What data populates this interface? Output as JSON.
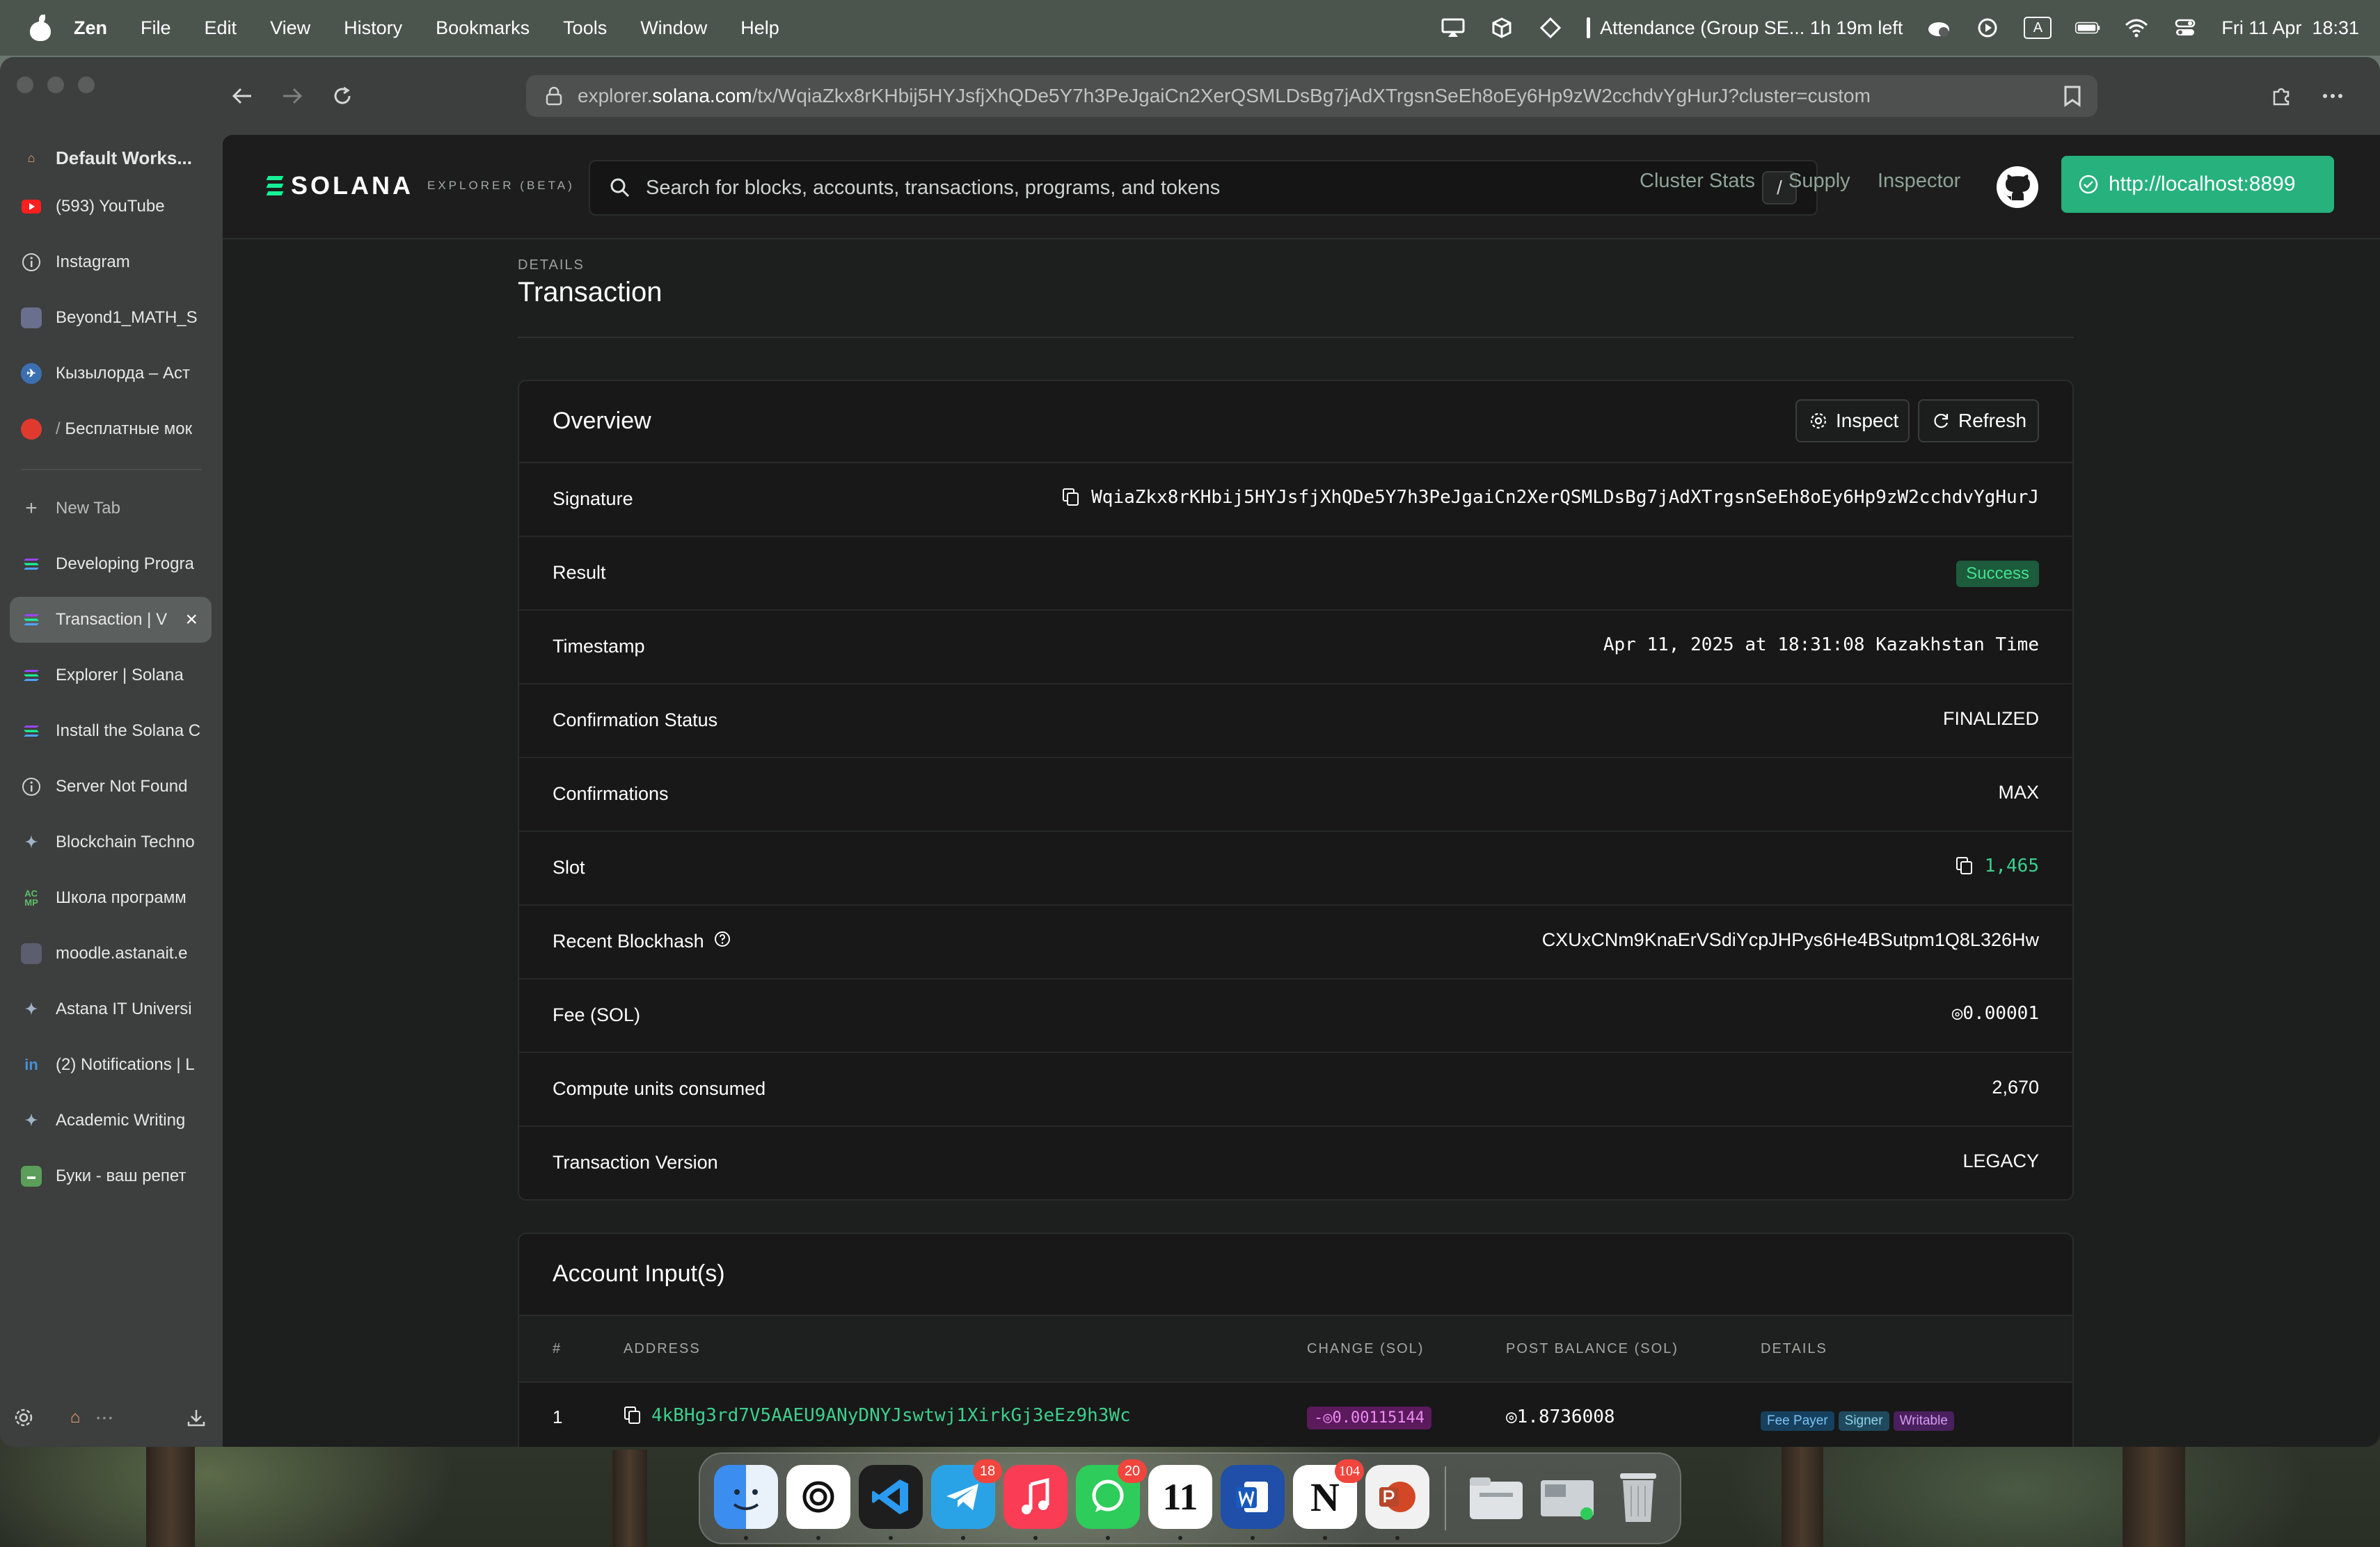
{
  "menubar": {
    "app_name": "Zen",
    "menus": [
      "File",
      "Edit",
      "View",
      "History",
      "Bookmarks",
      "Tools",
      "Window",
      "Help"
    ],
    "status_text": "Attendance (Group SE... 1h 19m left",
    "date_time": "Fri 11 Apr  18:31",
    "keyboard_input": "A"
  },
  "browser": {
    "url_prefix": "explorer.",
    "url_domain": "solana.com",
    "url_path": "/tx/WqiaZkx8rKHbij5HYJsfjXhQDe5Y7h3PeJgaiCn2XerQSMLDsBg7jAdXTrgsnSeEh8oEy6Hp9zW2cchdvYgHurJ?cluster=custom"
  },
  "sidebar": {
    "workspace": "Default Works...",
    "pinned": [
      {
        "label": "(593) YouTube",
        "icon": "youtube-icon"
      },
      {
        "label": "Instagram",
        "icon": "info-icon"
      },
      {
        "label": "Beyond1_MATH_S",
        "icon": "page-icon"
      },
      {
        "label": "Кызылорда – Аст",
        "icon": "plane-icon"
      },
      {
        "label": "Бесплатные мок",
        "icon": "red-dot-icon"
      }
    ],
    "new_tab": "New Tab",
    "tabs": [
      {
        "label": "Developing Progra",
        "icon": "solana-icon"
      },
      {
        "label": "Transaction | V",
        "icon": "solana-icon",
        "active": true
      },
      {
        "label": "Explorer | Solana",
        "icon": "solana-icon"
      },
      {
        "label": "Install the Solana C",
        "icon": "solana-icon"
      },
      {
        "label": "Server Not Found",
        "icon": "info-icon"
      },
      {
        "label": "Blockchain Techno",
        "icon": "sparkle-icon"
      },
      {
        "label": "Школа программ",
        "icon": "acmp-icon"
      },
      {
        "label": "moodle.astanait.e",
        "icon": "page-icon"
      },
      {
        "label": "Astana IT Universi",
        "icon": "sparkle-icon"
      },
      {
        "label": "(2) Notifications | L",
        "icon": "linkedin-icon"
      },
      {
        "label": "Academic Writing",
        "icon": "sparkle-icon"
      },
      {
        "label": "Буки - ваш репет",
        "icon": "buki-icon"
      }
    ]
  },
  "explorer": {
    "brand": "SOLANA",
    "brand_sub": "EXPLORER (BETA)",
    "search_placeholder": "Search for blocks, accounts, transactions, programs, and tokens",
    "search_shortcut": "/",
    "nav": [
      "Cluster Stats",
      "Supply",
      "Inspector"
    ],
    "cluster_label": "http://localhost:8899",
    "details_pretitle": "DETAILS",
    "details_title": "Transaction",
    "overview": {
      "title": "Overview",
      "inspect_label": "Inspect",
      "refresh_label": "Refresh",
      "signature_label": "Signature",
      "signature": "WqiaZkx8rKHbij5HYJsfjXhQDe5Y7h3PeJgaiCn2XerQSMLDsBg7jAdXTrgsnSeEh8oEy6Hp9zW2cchdvYgHurJ",
      "result_label": "Result",
      "result": "Success",
      "timestamp_label": "Timestamp",
      "timestamp": "Apr 11, 2025 at 18:31:08 Kazakhstan Time",
      "confirmation_status_label": "Confirmation Status",
      "confirmation_status": "FINALIZED",
      "confirmations_label": "Confirmations",
      "confirmations": "MAX",
      "slot_label": "Slot",
      "slot": "1,465",
      "blockhash_label": "Recent Blockhash",
      "blockhash": "CXUxCNm9KnaErVSdiYcpJHPys6He4BSutpm1Q8L326Hw",
      "fee_label": "Fee (SOL)",
      "fee": "◎0.00001",
      "compute_label": "Compute units consumed",
      "compute": "2,670",
      "version_label": "Transaction Version",
      "version": "LEGACY"
    },
    "accounts": {
      "title": "Account Input(s)",
      "columns": [
        "#",
        "ADDRESS",
        "CHANGE (SOL)",
        "POST BALANCE (SOL)",
        "DETAILS"
      ],
      "rows": [
        {
          "index": "1",
          "address": "4kBHg3rd7V5AAEU9ANyDNYJswtwj1XirkGj3eEz9h3Wc",
          "change": "-◎0.00115144",
          "post_balance": "◎1.8736008",
          "tags": [
            "Fee Payer",
            "Signer",
            "Writable"
          ]
        }
      ]
    }
  },
  "dock": {
    "apps": [
      {
        "name": "finder-icon"
      },
      {
        "name": "chatgpt-icon"
      },
      {
        "name": "vscode-icon"
      },
      {
        "name": "telegram-icon",
        "badge": "18"
      },
      {
        "name": "music-icon"
      },
      {
        "name": "whatsapp-icon",
        "badge": "20"
      },
      {
        "name": "calendar-icon",
        "day": "11"
      },
      {
        "name": "word-icon"
      },
      {
        "name": "notion-icon",
        "badge": "104"
      },
      {
        "name": "powerpoint-icon"
      },
      {
        "name": "folder-icon"
      },
      {
        "name": "screenshot-icon"
      },
      {
        "name": "trash-icon"
      }
    ]
  }
}
